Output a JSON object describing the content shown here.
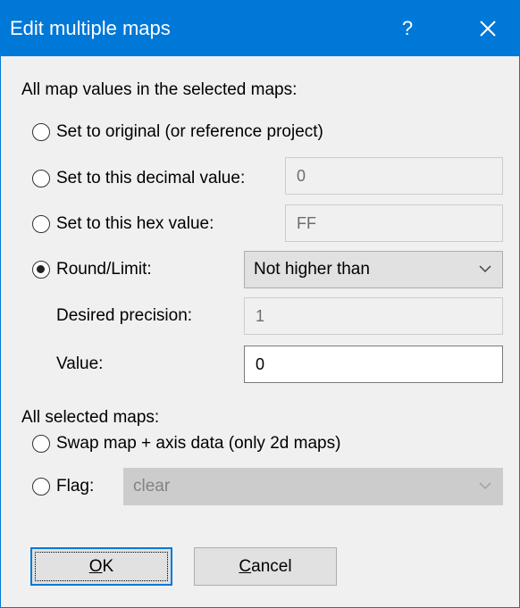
{
  "window": {
    "title": "Edit multiple maps"
  },
  "titlebar": {
    "help_glyph": "?",
    "close_icon": "close-icon"
  },
  "section_values": {
    "heading": "All map values in the selected maps:"
  },
  "options": {
    "original": {
      "label": "Set to original (or reference project)",
      "checked": false
    },
    "decimal": {
      "label": "Set to this decimal value:",
      "value": "0",
      "checked": false
    },
    "hex": {
      "label": "Set to this hex value:",
      "value": "FF",
      "checked": false
    },
    "round": {
      "label": "Round/Limit:",
      "selected": "Not higher than",
      "checked": true
    }
  },
  "precision": {
    "label": "Desired precision:",
    "value": "1"
  },
  "value_field": {
    "label": "Value:",
    "value": "0"
  },
  "section_maps": {
    "heading": "All selected maps:"
  },
  "maps_options": {
    "swap": {
      "label": "Swap map + axis data (only 2d maps)",
      "checked": false
    },
    "flag": {
      "label": "Flag:",
      "selected": "clear",
      "checked": false
    }
  },
  "buttons": {
    "ok": "OK",
    "cancel": "Cancel"
  },
  "colors": {
    "accent": "#0078d7",
    "dialog_bg": "#f0f0f0"
  }
}
